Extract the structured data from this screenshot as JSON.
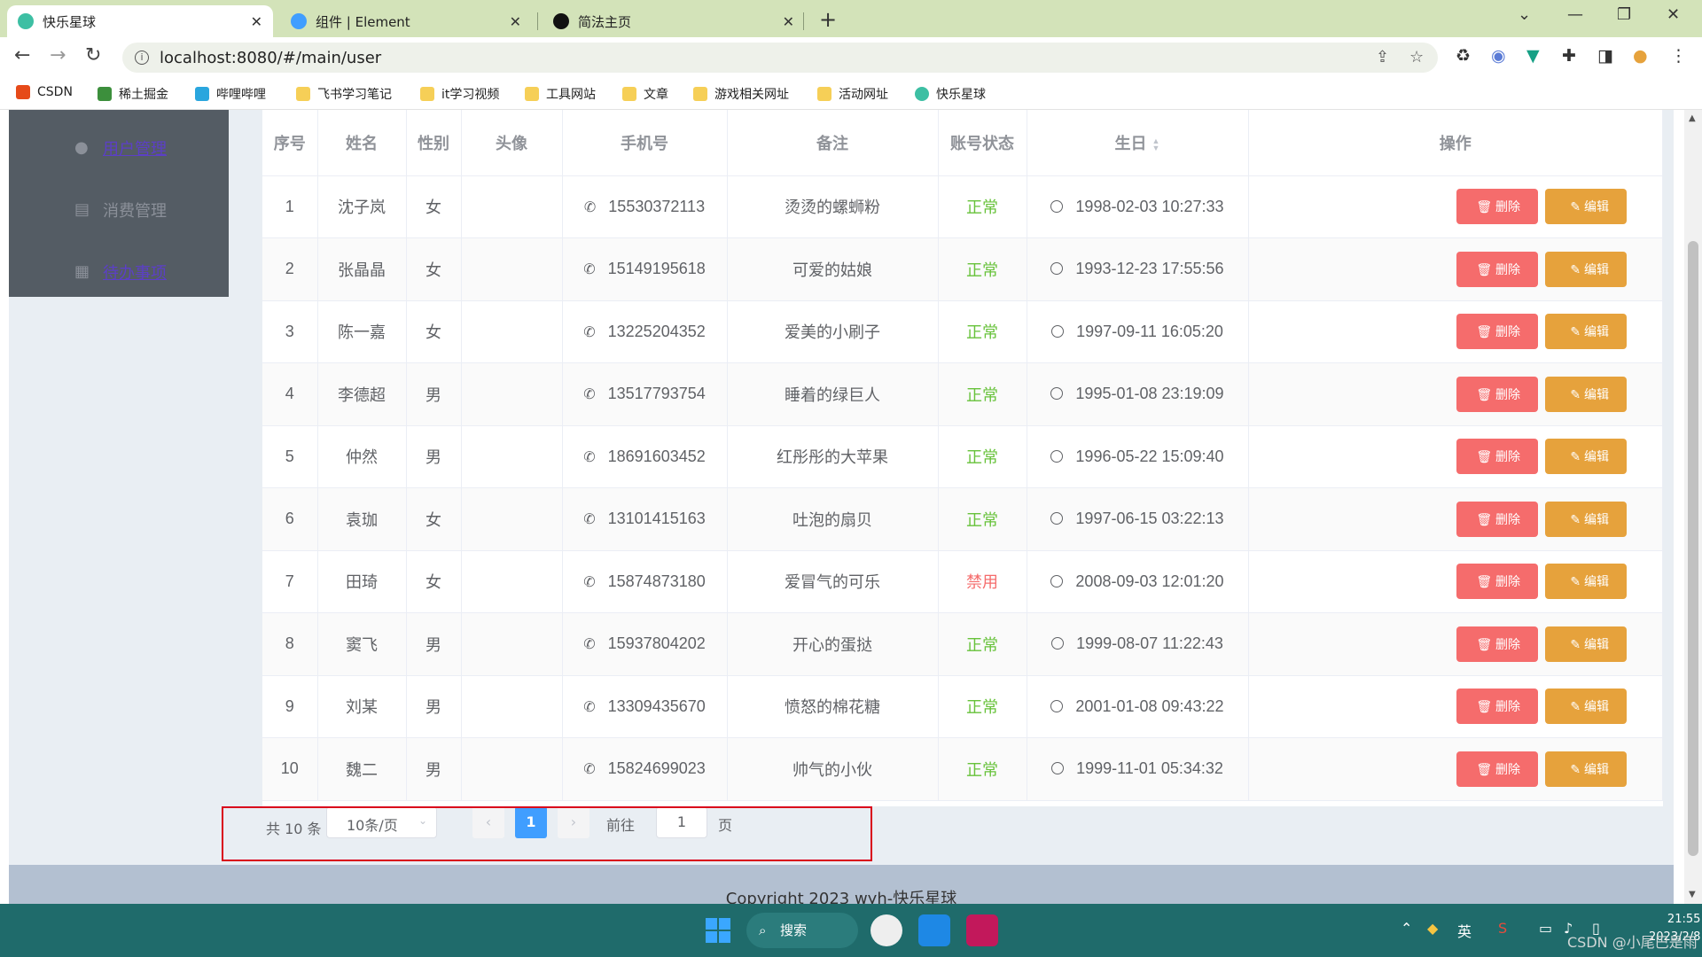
{
  "browser": {
    "tabs": [
      {
        "title": "快乐星球",
        "active": true
      },
      {
        "title": "组件 | Element",
        "active": false
      },
      {
        "title": "简法主页",
        "active": false
      }
    ],
    "url": "localhost:8080/#/main/user",
    "bookmarks": [
      "CSDN",
      "稀土掘金",
      "哔哩哔哩",
      "飞书学习笔记",
      "it学习视频",
      "工具网站",
      "文章",
      "游戏相关网址",
      "活动网址",
      "快乐星球"
    ]
  },
  "sidebar": {
    "items": [
      {
        "label": "用户管理",
        "icon": "user-icon",
        "link": true
      },
      {
        "label": "消费管理",
        "icon": "document-icon",
        "link": false
      },
      {
        "label": "待办事项",
        "icon": "grid-icon",
        "link": true
      }
    ]
  },
  "table": {
    "headers": [
      "序号",
      "姓名",
      "性别",
      "头像",
      "手机号",
      "备注",
      "账号状态",
      "生日",
      "操作"
    ],
    "delete_label": "删除",
    "edit_label": "编辑",
    "rows": [
      {
        "id": "1",
        "name": "沈子岚",
        "gender": "女",
        "phone": "15530372113",
        "note": "烫烫的螺蛳粉",
        "status": "正常",
        "birthday": "1998-02-03 10:27:33"
      },
      {
        "id": "2",
        "name": "张晶晶",
        "gender": "女",
        "phone": "15149195618",
        "note": "可爱的姑娘",
        "status": "正常",
        "birthday": "1993-12-23 17:55:56"
      },
      {
        "id": "3",
        "name": "陈一嘉",
        "gender": "女",
        "phone": "13225204352",
        "note": "爱美的小刷子",
        "status": "正常",
        "birthday": "1997-09-11 16:05:20"
      },
      {
        "id": "4",
        "name": "李德超",
        "gender": "男",
        "phone": "13517793754",
        "note": "睡着的绿巨人",
        "status": "正常",
        "birthday": "1995-01-08 23:19:09"
      },
      {
        "id": "5",
        "name": "仲然",
        "gender": "男",
        "phone": "18691603452",
        "note": "红彤彤的大苹果",
        "status": "正常",
        "birthday": "1996-05-22 15:09:40"
      },
      {
        "id": "6",
        "name": "袁珈",
        "gender": "女",
        "phone": "13101415163",
        "note": "吐泡的扇贝",
        "status": "正常",
        "birthday": "1997-06-15 03:22:13"
      },
      {
        "id": "7",
        "name": "田琦",
        "gender": "女",
        "phone": "15874873180",
        "note": "爱冒气的可乐",
        "status": "禁用",
        "birthday": "2008-09-03 12:01:20"
      },
      {
        "id": "8",
        "name": "窦飞",
        "gender": "男",
        "phone": "15937804202",
        "note": "开心的蛋挞",
        "status": "正常",
        "birthday": "1999-08-07 11:22:43"
      },
      {
        "id": "9",
        "name": "刘某",
        "gender": "男",
        "phone": "13309435670",
        "note": "愤怒的棉花糖",
        "status": "正常",
        "birthday": "2001-01-08 09:43:22"
      },
      {
        "id": "10",
        "name": "魏二",
        "gender": "男",
        "phone": "15824699023",
        "note": "帅气的小伙",
        "status": "正常",
        "birthday": "1999-11-01 05:34:32"
      }
    ]
  },
  "pagination": {
    "total": "共 10 条",
    "page_size": "10条/页",
    "current_page": "1",
    "goto_label": "前往",
    "goto_value": "1",
    "page_suffix": "页"
  },
  "footer": {
    "text": "Copyright 2023 wyh-快乐星球"
  },
  "taskbar": {
    "search_label": "搜索",
    "ime": "英",
    "time": "21:55",
    "date": "2023/2/8"
  },
  "watermark": "CSDN @小尾巴是雨泽",
  "colors": {
    "primary": "#409eff",
    "danger": "#f56c6c",
    "warning": "#e6a23c",
    "success": "#67c23a",
    "sidebar": "#545c64"
  }
}
